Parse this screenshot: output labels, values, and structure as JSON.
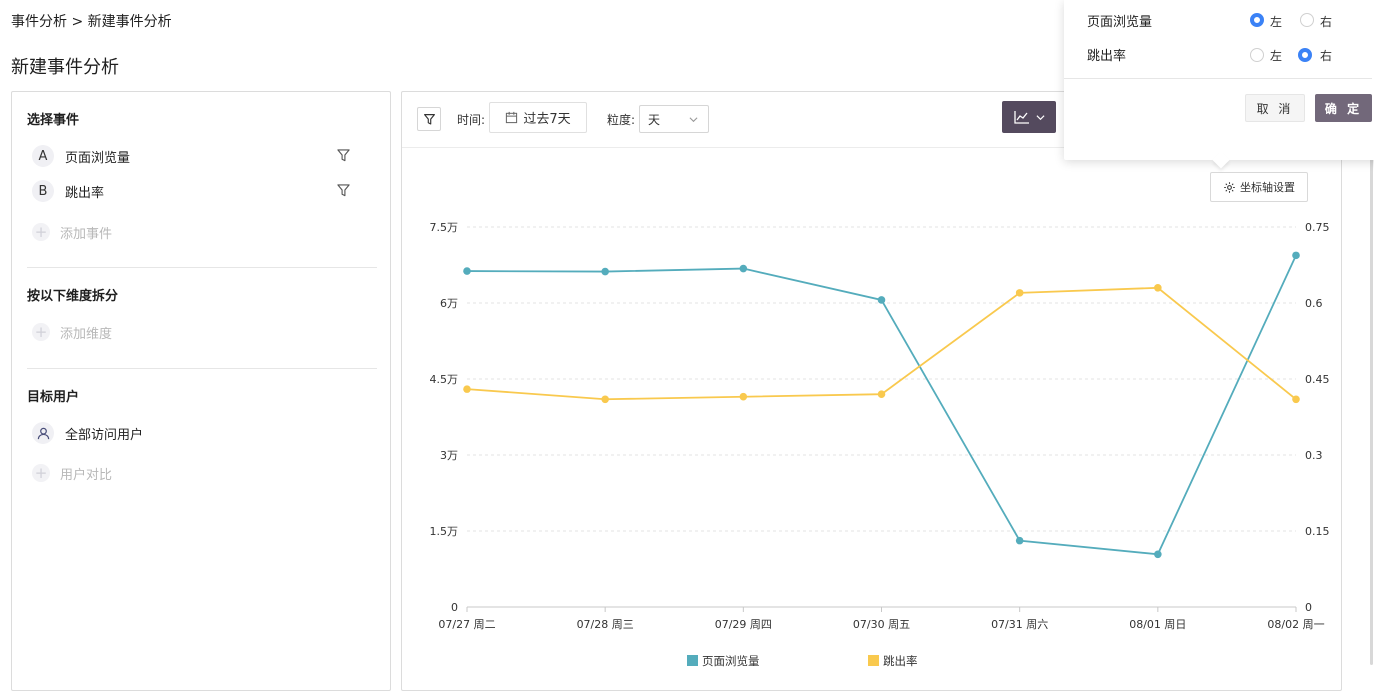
{
  "breadcrumb": "事件分析 > 新建事件分析",
  "page_title": "新建事件分析",
  "left": {
    "select_events_title": "选择事件",
    "events": [
      {
        "badge": "A",
        "name": "页面浏览量"
      },
      {
        "badge": "B",
        "name": "跳出率"
      }
    ],
    "add_event": "添加事件",
    "breakdown_title": "按以下维度拆分",
    "add_dimension": "添加维度",
    "target_users_title": "目标用户",
    "all_users": "全部访问用户",
    "user_compare": "用户对比"
  },
  "toolbar": {
    "time_label": "时间:",
    "time_value": "过去7天",
    "granularity_label": "粒度:",
    "granularity_value": "天",
    "axis_settings": "坐标轴设置"
  },
  "popover": {
    "rows": [
      {
        "label": "页面浏览量",
        "left": "左",
        "right": "右",
        "selected": "left"
      },
      {
        "label": "跳出率",
        "left": "左",
        "right": "右",
        "selected": "right"
      }
    ],
    "cancel": "取 消",
    "confirm": "确 定"
  },
  "colors": {
    "series_a": "#54acbc",
    "series_b": "#f9c94e",
    "primary": "#544a5e",
    "radio": "#3b82f6"
  },
  "chart_data": {
    "type": "line",
    "categories": [
      "07/27 周二",
      "07/28 周三",
      "07/29 周四",
      "07/30 周五",
      "07/31 周六",
      "08/01 周日",
      "08/02 周一"
    ],
    "series": [
      {
        "name": "页面浏览量",
        "axis": "left",
        "values": [
          66300,
          66200,
          66800,
          60600,
          13100,
          10400,
          69400
        ]
      },
      {
        "name": "跳出率",
        "axis": "right",
        "values": [
          0.43,
          0.41,
          0.415,
          0.42,
          0.62,
          0.63,
          0.41
        ]
      }
    ],
    "y_left": {
      "ticks": [
        "0",
        "1.5万",
        "3万",
        "4.5万",
        "6万",
        "7.5万"
      ],
      "ylim": [
        0,
        75000
      ]
    },
    "y_right": {
      "ticks": [
        "0",
        "0.15",
        "0.3",
        "0.45",
        "0.6",
        "0.75"
      ],
      "ylim": [
        0,
        0.75
      ]
    },
    "grid": true,
    "legend": "bottom"
  }
}
